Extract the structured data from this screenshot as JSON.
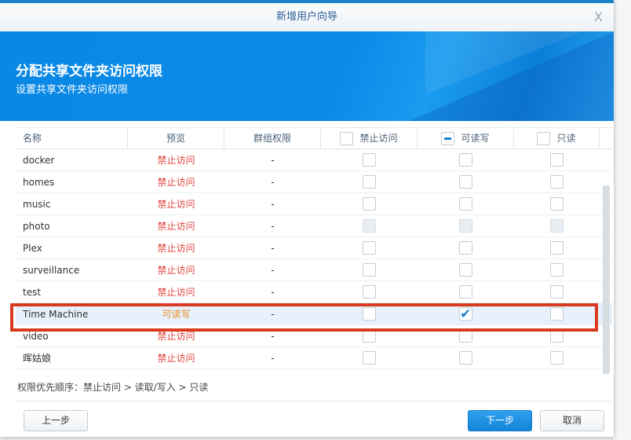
{
  "dialog": {
    "title": "新增用户向导",
    "close": "X"
  },
  "banner": {
    "title": "分配共享文件夹访问权限",
    "subtitle": "设置共享文件夹访问权限"
  },
  "table": {
    "headers": {
      "name": "名称",
      "preview": "预览",
      "group": "群组权限",
      "deny": "禁止访问",
      "rw": "可读写",
      "ro": "只读"
    },
    "rows": [
      {
        "name": "docker",
        "preview": "禁止访问",
        "group": "-"
      },
      {
        "name": "homes",
        "preview": "禁止访问",
        "group": "-"
      },
      {
        "name": "music",
        "preview": "禁止访问",
        "group": "-"
      },
      {
        "name": "photo",
        "preview": "禁止访问",
        "group": "-"
      },
      {
        "name": "Plex",
        "preview": "禁止访问",
        "group": "-"
      },
      {
        "name": "surveillance",
        "preview": "禁止访问",
        "group": "-"
      },
      {
        "name": "test",
        "preview": "禁止访问",
        "group": "-"
      },
      {
        "name": "Time Machine",
        "preview": "可读写",
        "group": "-"
      },
      {
        "name": "video",
        "preview": "禁止访问",
        "group": "-"
      },
      {
        "name": "晖姑娘",
        "preview": "禁止访问",
        "group": "-"
      }
    ]
  },
  "note": "权限优先顺序：禁止访问 > 读取/写入 > 只读",
  "buttons": {
    "back": "上一步",
    "next": "下一步",
    "cancel": "取消"
  }
}
